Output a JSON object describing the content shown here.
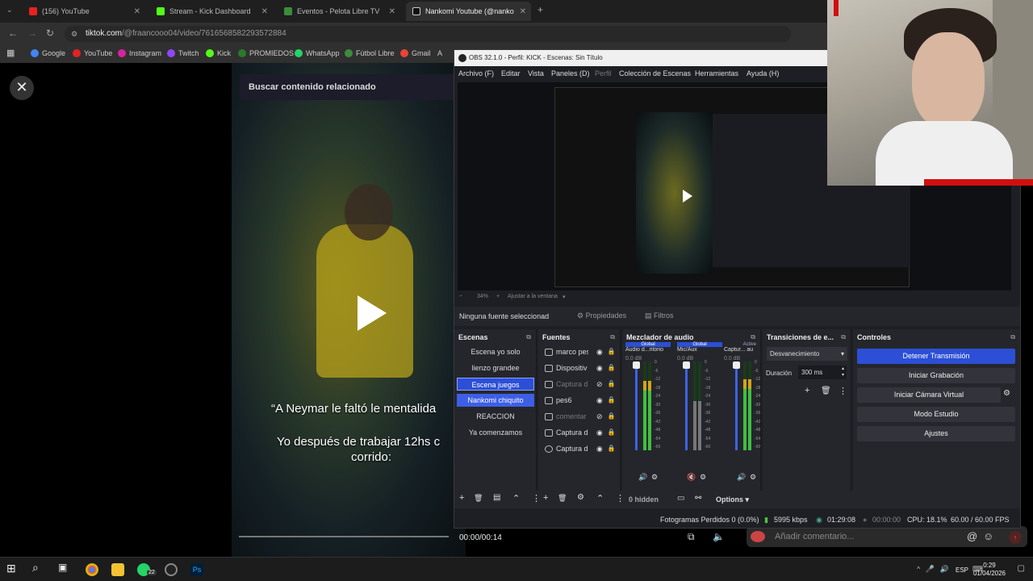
{
  "browser": {
    "tabs": [
      {
        "label": "(156) YouTube",
        "color": "#e52222"
      },
      {
        "label": "Stream - Kick Dashboard",
        "color": "#53fc18"
      },
      {
        "label": "Eventos - Pelota Libre TV",
        "color": "#3c8c3c"
      },
      {
        "label": "Nankomi Youtube (@nankomi",
        "color": "#111111"
      }
    ],
    "new_tab": "+",
    "url_host": "tiktok.com",
    "url_path": "/@fraancooo04/video/7616568582293572884",
    "bookmarks": [
      {
        "label": "Google",
        "color": "#4285f4"
      },
      {
        "label": "YouTube",
        "color": "#e52222"
      },
      {
        "label": "Instagram",
        "color": "#d6249f"
      },
      {
        "label": "Twitch",
        "color": "#9146ff"
      },
      {
        "label": "Kick",
        "color": "#53fc18"
      },
      {
        "label": "PROMIEDOS",
        "color": "#2a7a2a"
      },
      {
        "label": "WhatsApp",
        "color": "#25d366"
      },
      {
        "label": "Fútbol Libre",
        "color": "#3c8c3c"
      },
      {
        "label": "Gmail",
        "color": "#ea4335"
      },
      {
        "label": "A",
        "color": "#999999"
      }
    ]
  },
  "tiktok": {
    "search_related": "Buscar contenido relacionado",
    "caption1": "“A Neymar le faltó le mentalida",
    "caption2": "Yo después de trabajar 12hs c",
    "caption3": "corrido:",
    "timecode": "00:00/00:14",
    "comment_placeholder": "Añadir comentario...",
    "at_symbol": "@"
  },
  "obs": {
    "title": "OBS 32.1.0 - Perfil: KICK - Escenas: Sin Título",
    "menu": [
      "Archivo (F)",
      "Editar",
      "Vista",
      "Paneles (D)",
      "Perfil",
      "Colección de Escenas",
      "Herramientas",
      "Ayuda (H)"
    ],
    "zoom": "34%",
    "fit_window": "Ajustar a la ventana",
    "no_source": "Ninguna fuente seleccionad",
    "properties": "Propiedades",
    "filters": "Filtros",
    "scenes_title": "Escenas",
    "scenes": [
      "Escena yo solo",
      "lienzo grandee",
      "Escena juegos",
      "Nankomi chiquito",
      "REACCION",
      "Ya comenzamos"
    ],
    "sources_title": "Fuentes",
    "sources": [
      {
        "label": "marco pes",
        "dim": false
      },
      {
        "label": "Dispositiv",
        "dim": false
      },
      {
        "label": "Captura d",
        "dim": true
      },
      {
        "label": "pes6",
        "dim": false
      },
      {
        "label": "comentar",
        "dim": true
      },
      {
        "label": "Captura d",
        "dim": false
      },
      {
        "label": "Captura d",
        "dim": false
      }
    ],
    "mixer_title": "Mezclador de audio",
    "mixer_tracks": [
      {
        "badge": "Global",
        "name": "Audio d...ritorio",
        "db": "0.0 dB",
        "level": 0.78
      },
      {
        "badge": "Global",
        "name": "Mic/Aux",
        "db": "0.0 dB",
        "level": 0.55
      },
      {
        "badge": "Active",
        "name": "Captur... au",
        "db": "0.0 dB",
        "level": 0.8
      }
    ],
    "meter_ticks": [
      "0",
      "-6",
      "-12",
      "-18",
      "-24",
      "-30",
      "-36",
      "-42",
      "-48",
      "-54",
      "-60"
    ],
    "hidden": "0 hidden",
    "options": "Options",
    "transitions_title": "Transiciones de e...",
    "transition": "Desvanecimiento",
    "duration_label": "Duración",
    "duration_value": "300 ms",
    "controls_title": "Controles",
    "controls": [
      "Detener Transmisión",
      "Iniciar Grabación",
      "Iniciar Cámara Virtual",
      "Modo Estudio",
      "Ajustes"
    ],
    "status": {
      "dropped": "Fotogramas Perdidos 0 (0.0%)",
      "bitrate": "5995 kbps",
      "stream_time": "01:29:08",
      "rec_time": "00:00:00",
      "cpu": "CPU: 18.1%",
      "fps": "60.00 / 60.00 FPS"
    }
  },
  "taskbar": {
    "badge": "22",
    "lang": "ESP",
    "time": "0:29",
    "date": "01/04/2026"
  }
}
